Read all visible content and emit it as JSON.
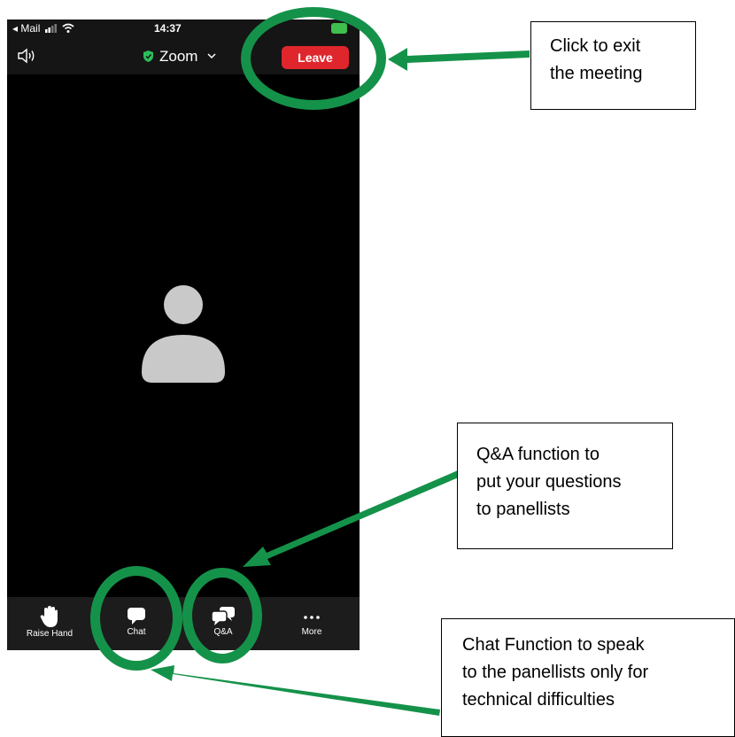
{
  "status_bar": {
    "carrier": "◂ Mail",
    "time": "14:37"
  },
  "header": {
    "title": "Zoom",
    "leave_label": "Leave"
  },
  "icons": {
    "speaker": "speaker-icon",
    "shield": "shield-check-icon",
    "chevron": "chevron-down-icon",
    "avatar": "person-avatar-icon"
  },
  "toolbar": {
    "items": [
      {
        "label": "Raise Hand",
        "icon": "hand-icon"
      },
      {
        "label": "Chat",
        "icon": "chat-bubble-icon"
      },
      {
        "label": "Q&A",
        "icon": "qa-bubbles-icon"
      },
      {
        "label": "More",
        "icon": "more-dots-icon"
      }
    ]
  },
  "annotations": {
    "leave_note": [
      "Click to exit",
      "the meeting"
    ],
    "qa_note": [
      "Q&A function to",
      "put your questions",
      "to panellists"
    ],
    "chat_note": [
      "Chat Function to speak",
      "to the panellists only for",
      "technical difficulties"
    ]
  },
  "colors": {
    "highlight": "#15924a",
    "leave": "#e0262d",
    "battery": "#3fbf4e",
    "shield": "#2bbf5c"
  }
}
